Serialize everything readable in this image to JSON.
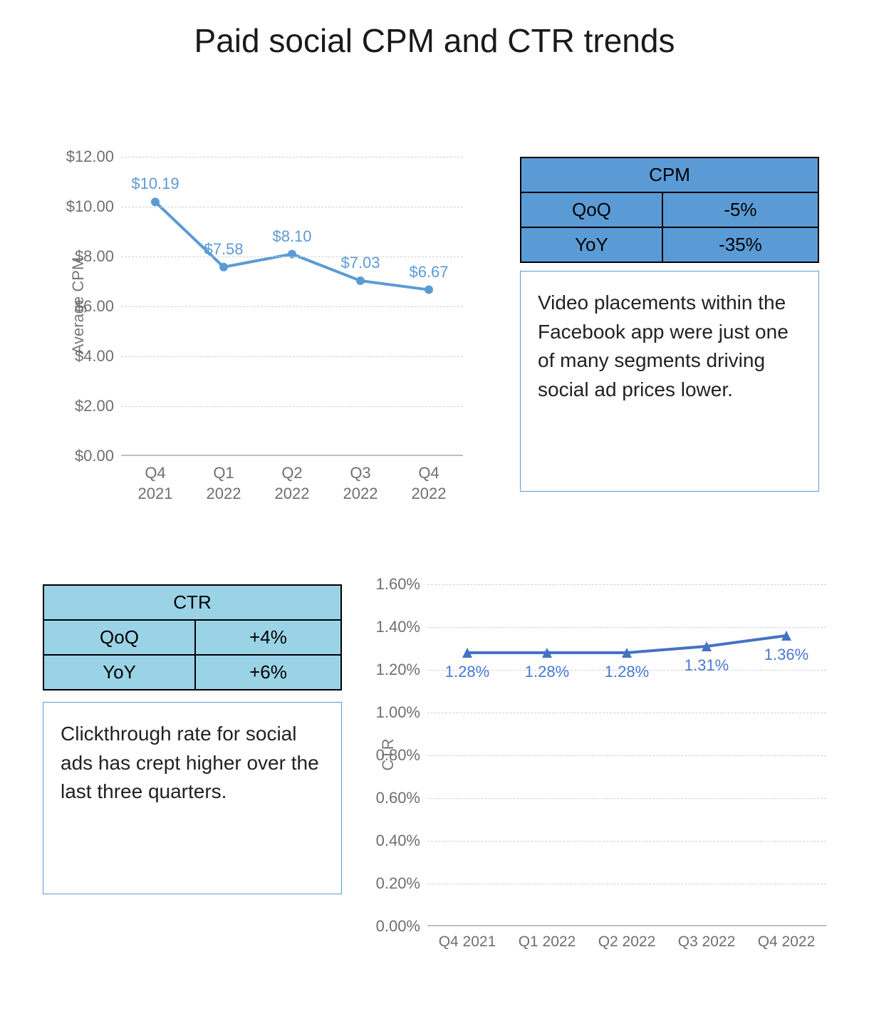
{
  "title": "Paid social CPM and CTR trends",
  "chart_data": [
    {
      "id": "cpm",
      "type": "line",
      "ylabel": "Average CPM",
      "ylim": [
        0,
        12
      ],
      "ystep": 2,
      "yformat": "currency",
      "categories": [
        "Q4 2021",
        "Q1 2022",
        "Q2 2022",
        "Q3 2022",
        "Q4 2022"
      ],
      "values": [
        10.19,
        7.58,
        8.1,
        7.03,
        6.67
      ],
      "marker_color": "#5b9bd5"
    },
    {
      "id": "ctr",
      "type": "line",
      "ylabel": "CTR",
      "ylim": [
        0,
        1.6
      ],
      "ystep": 0.2,
      "yformat": "percent",
      "categories": [
        "Q4 2021",
        "Q1 2022",
        "Q2 2022",
        "Q3 2022",
        "Q4 2022"
      ],
      "values": [
        1.28,
        1.28,
        1.28,
        1.31,
        1.36
      ],
      "marker_color": "#4472c4"
    }
  ],
  "cpm_table": {
    "header": "CPM",
    "rows": [
      {
        "label": "QoQ",
        "value": "-5%"
      },
      {
        "label": "YoY",
        "value": "-35%"
      }
    ]
  },
  "cpm_callout": "Video placements within the Facebook app were just one of many segments driving social ad prices lower.",
  "ctr_table": {
    "header": "CTR",
    "rows": [
      {
        "label": "QoQ",
        "value": "+4%"
      },
      {
        "label": "YoY",
        "value": "+6%"
      }
    ]
  },
  "ctr_callout": "Clickthrough rate for social ads has crept higher over the last three quarters."
}
